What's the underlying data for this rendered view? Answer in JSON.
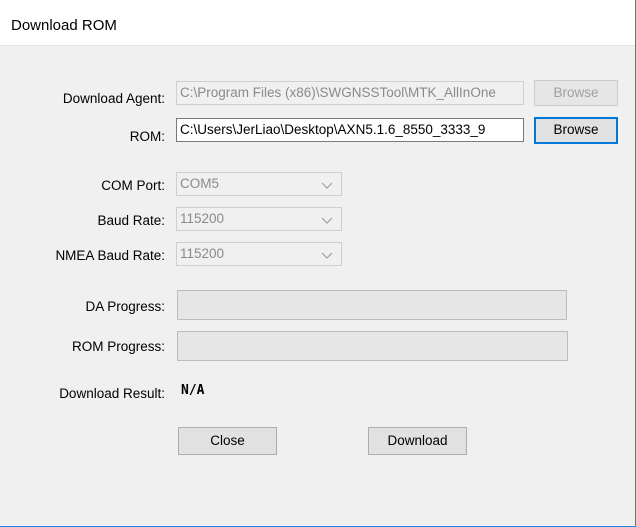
{
  "window": {
    "title": "Download ROM"
  },
  "download_agent": {
    "label": "Download Agent:",
    "value": "C:\\Program Files (x86)\\SWGNSSTool\\MTK_AllInOne",
    "browse_label": "Browse"
  },
  "rom": {
    "label": "ROM:",
    "value": "C:\\Users\\JerLiao\\Desktop\\AXN5.1.6_8550_3333_9",
    "browse_label": "Browse"
  },
  "com_port": {
    "label": "COM Port:",
    "value": "COM5"
  },
  "baud_rate": {
    "label": "Baud Rate:",
    "value": "115200"
  },
  "nmea_baud_rate": {
    "label": "NMEA Baud Rate:",
    "value": "115200"
  },
  "da_progress": {
    "label": "DA Progress:",
    "value": 0
  },
  "rom_progress": {
    "label": "ROM Progress:",
    "value": 0
  },
  "download_result": {
    "label": "Download Result:",
    "value": "N/A"
  },
  "buttons": {
    "close": "Close",
    "download": "Download"
  },
  "colors": {
    "accent": "#0078d7",
    "window_border": "#1e88e5",
    "background": "#f0f0f0"
  },
  "icons": {
    "combo_arrow": "chevron-down-icon"
  }
}
